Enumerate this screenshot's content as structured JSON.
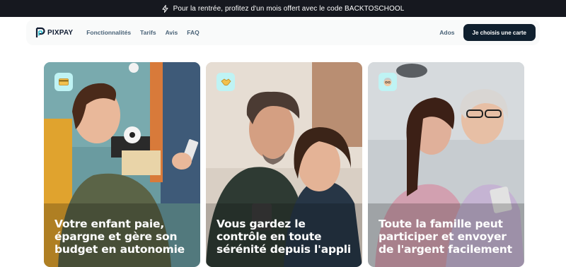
{
  "promo": {
    "text": "Pour la rentrée, profitez d'un mois offert avec le code BACKTOSCHOOL",
    "icon": "lightning-icon"
  },
  "nav": {
    "logo": "PIXPAY",
    "links": [
      "Fonctionnalités",
      "Tarifs",
      "Avis",
      "FAQ"
    ],
    "ados": "Ados",
    "cta": "Je choisis une carte"
  },
  "cards": [
    {
      "title_lines": [
        "Votre enfant paie,",
        "épargne et gère son",
        "budget en autonomie"
      ],
      "badge_icon": "credit-card-icon",
      "badge_color": "#bff3f4"
    },
    {
      "title_lines": [
        "Vous gardez le",
        "contrôle en toute",
        "sérénité depuis l'appli"
      ],
      "badge_icon": "handshake-icon",
      "badge_color": "#bff3f4"
    },
    {
      "title_lines": [
        "Toute la famille peut",
        "participer et envoyer",
        "de l'argent facilement"
      ],
      "badge_icon": "grandparent-icon",
      "badge_color": "#bff3f4"
    }
  ],
  "colors": {
    "promo_bg": "#16181f",
    "nav_bg": "#f9fafa",
    "cta_bg": "#0f1f2e",
    "link": "#4a6378",
    "badge": "#bff3f4"
  }
}
